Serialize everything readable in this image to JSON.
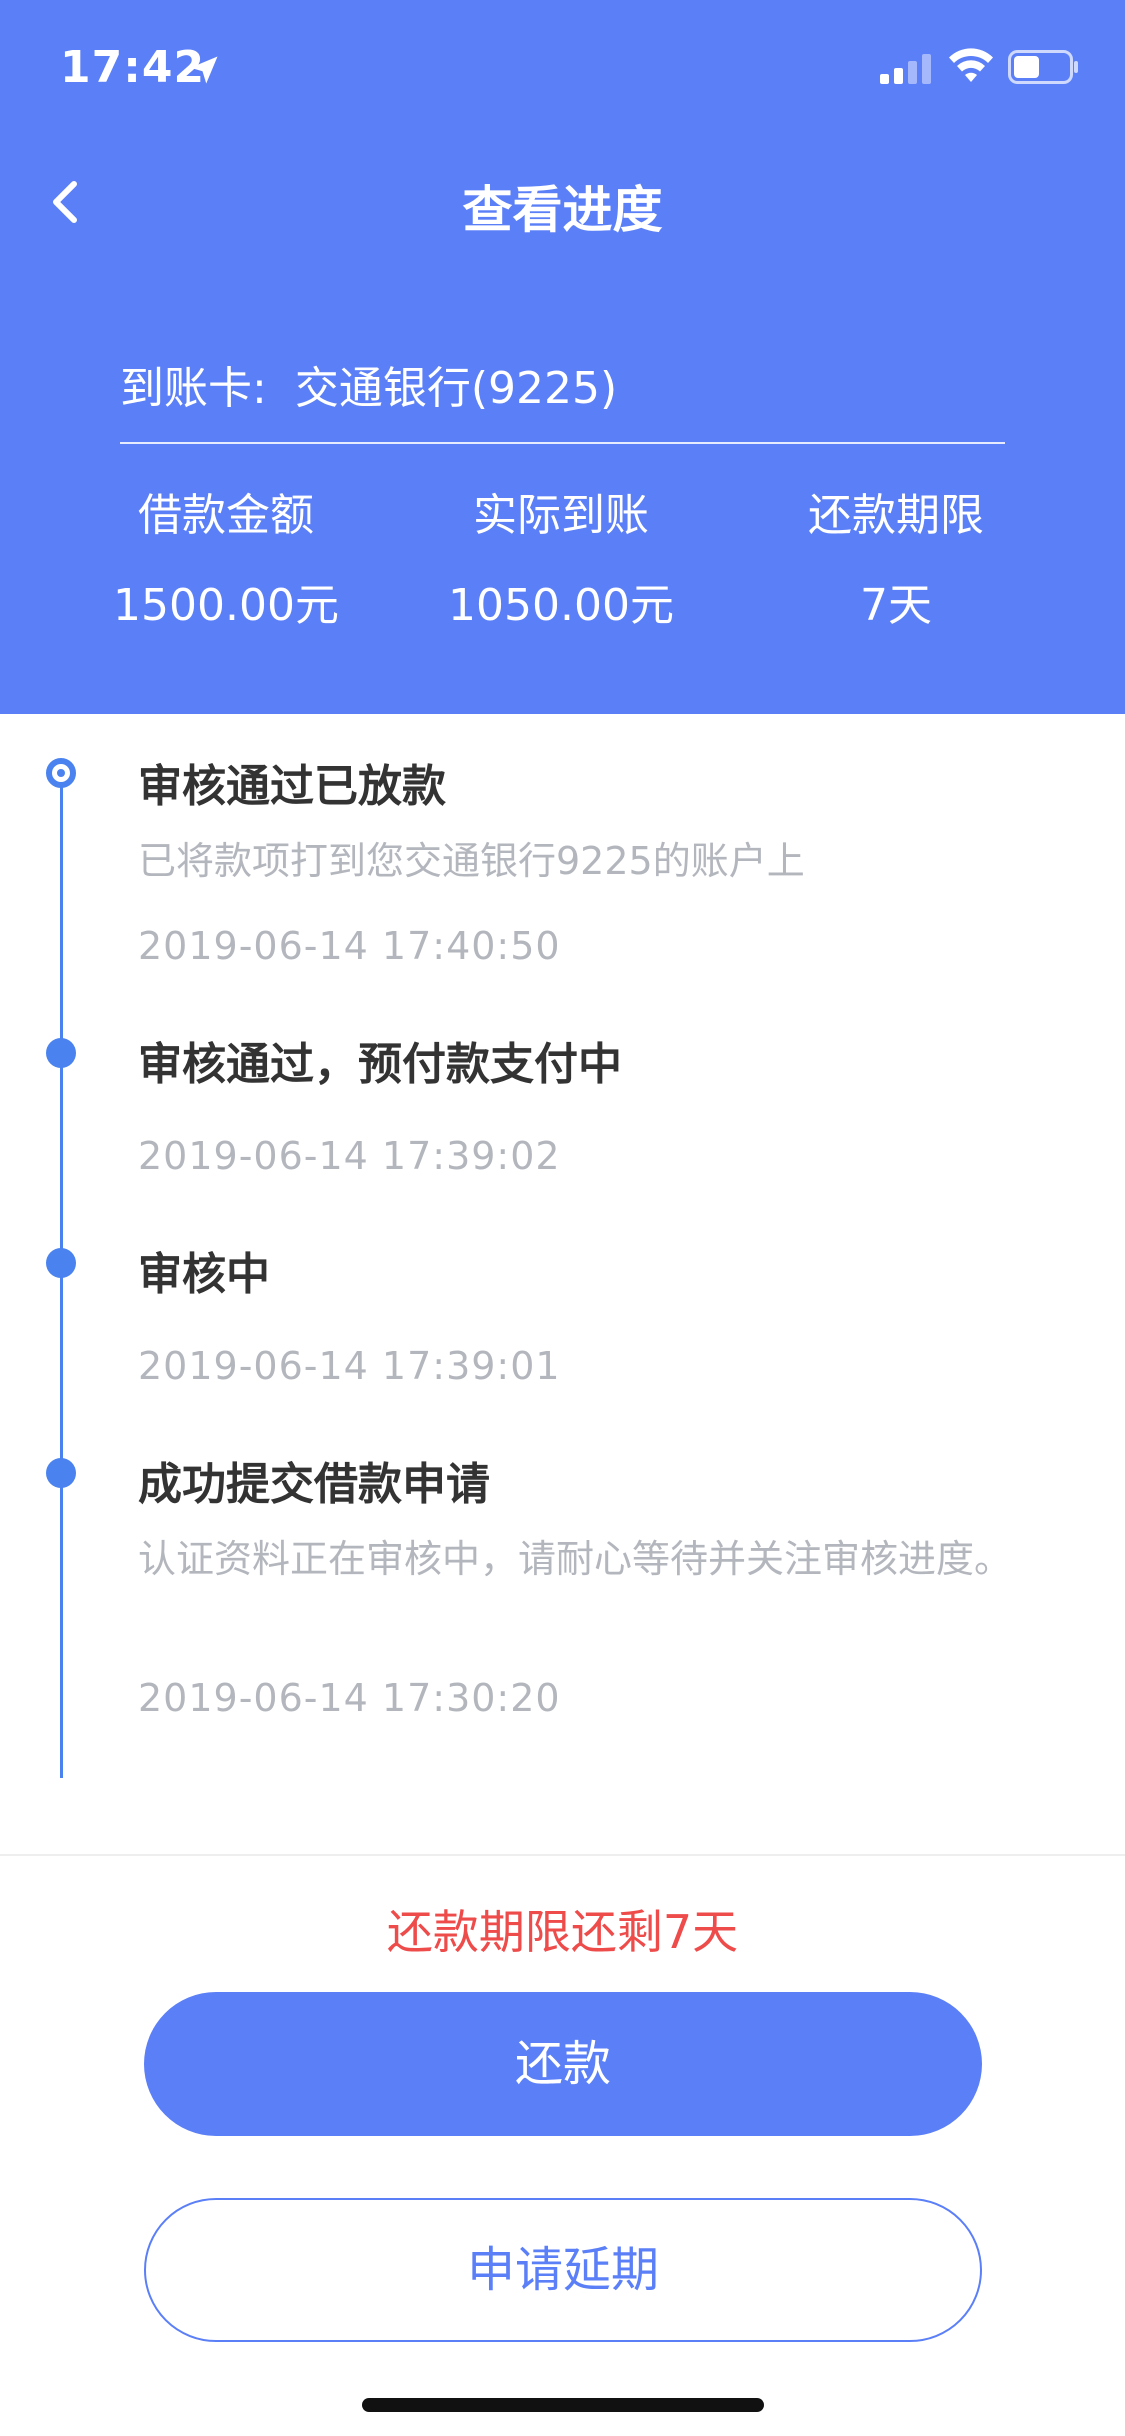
{
  "status_bar": {
    "time": "17:42"
  },
  "nav": {
    "title": "查看进度"
  },
  "card": {
    "label": "到账卡:",
    "bank": "交通银行(9225)"
  },
  "stats": [
    {
      "label": "借款金额",
      "value": "1500.00元"
    },
    {
      "label": "实际到账",
      "value": "1050.00元"
    },
    {
      "label": "还款期限",
      "value": "7天"
    }
  ],
  "timeline": [
    {
      "title": "审核通过已放款",
      "desc": "已将款项打到您交通银行9225的账户上",
      "time": "2019-06-14 17:40:50",
      "current": true
    },
    {
      "title": "审核通过，预付款支付中",
      "desc": "",
      "time": "2019-06-14 17:39:02",
      "current": false
    },
    {
      "title": "审核中",
      "desc": "",
      "time": "2019-06-14 17:39:01",
      "current": false
    },
    {
      "title": "成功提交借款申请",
      "desc": "认证资料正在审核中，请耐心等待并关注审核进度。",
      "time": "2019-06-14 17:30:20",
      "current": false
    }
  ],
  "footer": {
    "remaining_text": "还款期限还剩7天",
    "repay_label": "还款",
    "extend_label": "申请延期"
  },
  "colors": {
    "primary": "#5b7ff7",
    "timeline": "#4a83f0",
    "warning": "#ee4b4b",
    "muted_text": "#b3b6bd"
  },
  "icons": {
    "back": "chevron-left-icon",
    "location": "location-arrow-icon",
    "signal": "cellular-signal-icon",
    "wifi": "wifi-icon",
    "battery": "battery-icon"
  }
}
